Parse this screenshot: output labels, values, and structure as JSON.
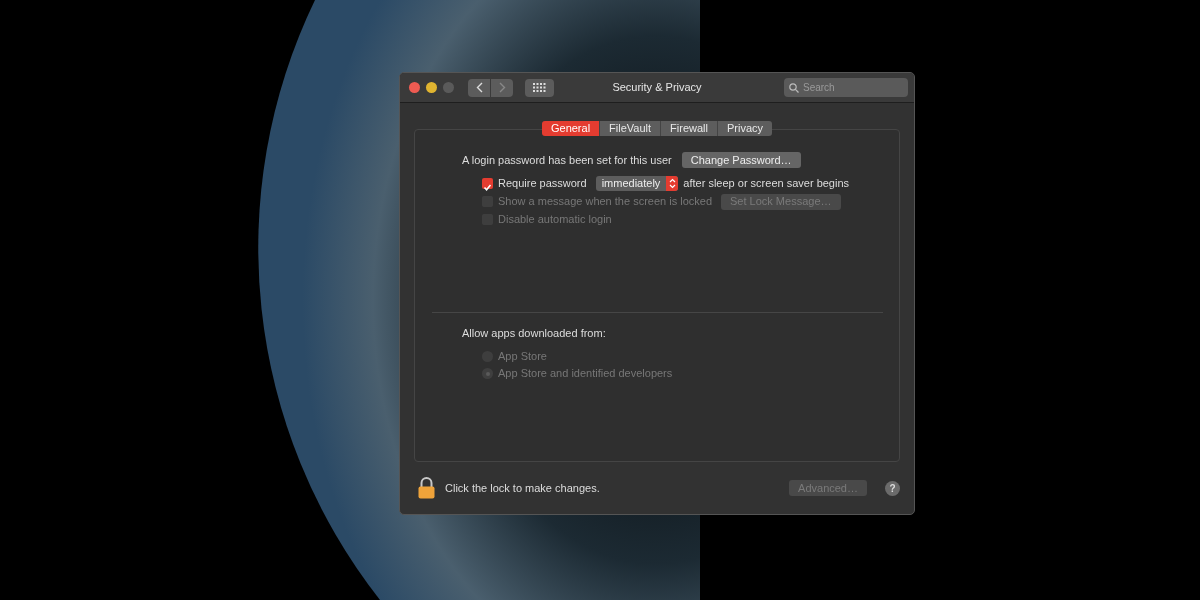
{
  "window": {
    "title": "Security & Privacy"
  },
  "search": {
    "placeholder": "Search"
  },
  "tabs": [
    {
      "label": "General",
      "selected": true
    },
    {
      "label": "FileVault",
      "selected": false
    },
    {
      "label": "Firewall",
      "selected": false
    },
    {
      "label": "Privacy",
      "selected": false
    }
  ],
  "login_text": "A login password has been set for this user",
  "change_password_button": "Change Password…",
  "options": [
    {
      "kind": "dropdown",
      "label": "Require password",
      "checked": true,
      "disabled": false,
      "value": "immediately",
      "suffix": "after sleep or screen saver begins"
    },
    {
      "kind": "button",
      "label": "Show a message when the screen is locked",
      "checked": false,
      "disabled": true,
      "button": "Set Lock Message…"
    },
    {
      "kind": "plain",
      "label": "Disable automatic login",
      "checked": false,
      "disabled": true
    }
  ],
  "allow_apps": {
    "label": "Allow apps downloaded from:",
    "options": [
      {
        "label": "App Store",
        "selected": false,
        "disabled": true
      },
      {
        "label": "App Store and identified developers",
        "selected": true,
        "disabled": true
      }
    ]
  },
  "footer": {
    "lock_text": "Click the lock to make changes.",
    "advanced_button": "Advanced…",
    "advanced_disabled": true,
    "help_button": "?"
  }
}
